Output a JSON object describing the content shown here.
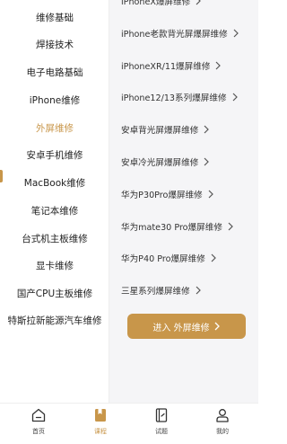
{
  "sidebar": {
    "items": [
      {
        "label": "维修基础"
      },
      {
        "label": "焊接技术"
      },
      {
        "label": "电子电路基础"
      },
      {
        "label": "iPhone维修"
      },
      {
        "label": "外屏维修"
      },
      {
        "label": "安卓手机维修"
      },
      {
        "label": "MacBook维修"
      },
      {
        "label": "笔记本维修"
      },
      {
        "label": "台式机主板维修"
      },
      {
        "label": "显卡维修"
      },
      {
        "label": "国产CPU主板维修"
      },
      {
        "label": "特斯拉新能源汽车维修"
      }
    ],
    "active_index": 4
  },
  "content": {
    "items": [
      {
        "label": "iPhoneX爆屏维修"
      },
      {
        "label": "iPhone老款背光屏爆屏维修"
      },
      {
        "label": "iPhoneXR/11爆屏维修"
      },
      {
        "label": "iPhone12/13系列爆屏维修"
      },
      {
        "label": "安卓背光屏爆屏维修"
      },
      {
        "label": "安卓冷光屏爆屏维修"
      },
      {
        "label": "华为P30Pro爆屏维修"
      },
      {
        "label": "华为mate30 Pro爆屏维修"
      },
      {
        "label": "华为P40 Pro爆屏维修"
      },
      {
        "label": "三星系列爆屏维修"
      }
    ],
    "enter_button": "进入 外屏维修"
  },
  "tabbar": {
    "items": [
      {
        "label": "首页",
        "icon": "home-icon"
      },
      {
        "label": "课程",
        "icon": "course-icon"
      },
      {
        "label": "试题",
        "icon": "exam-icon"
      },
      {
        "label": "我的",
        "icon": "profile-icon"
      }
    ],
    "active_index": 1
  },
  "colors": {
    "accent": "#c8964a",
    "content_bg": "#f5f5f7"
  }
}
